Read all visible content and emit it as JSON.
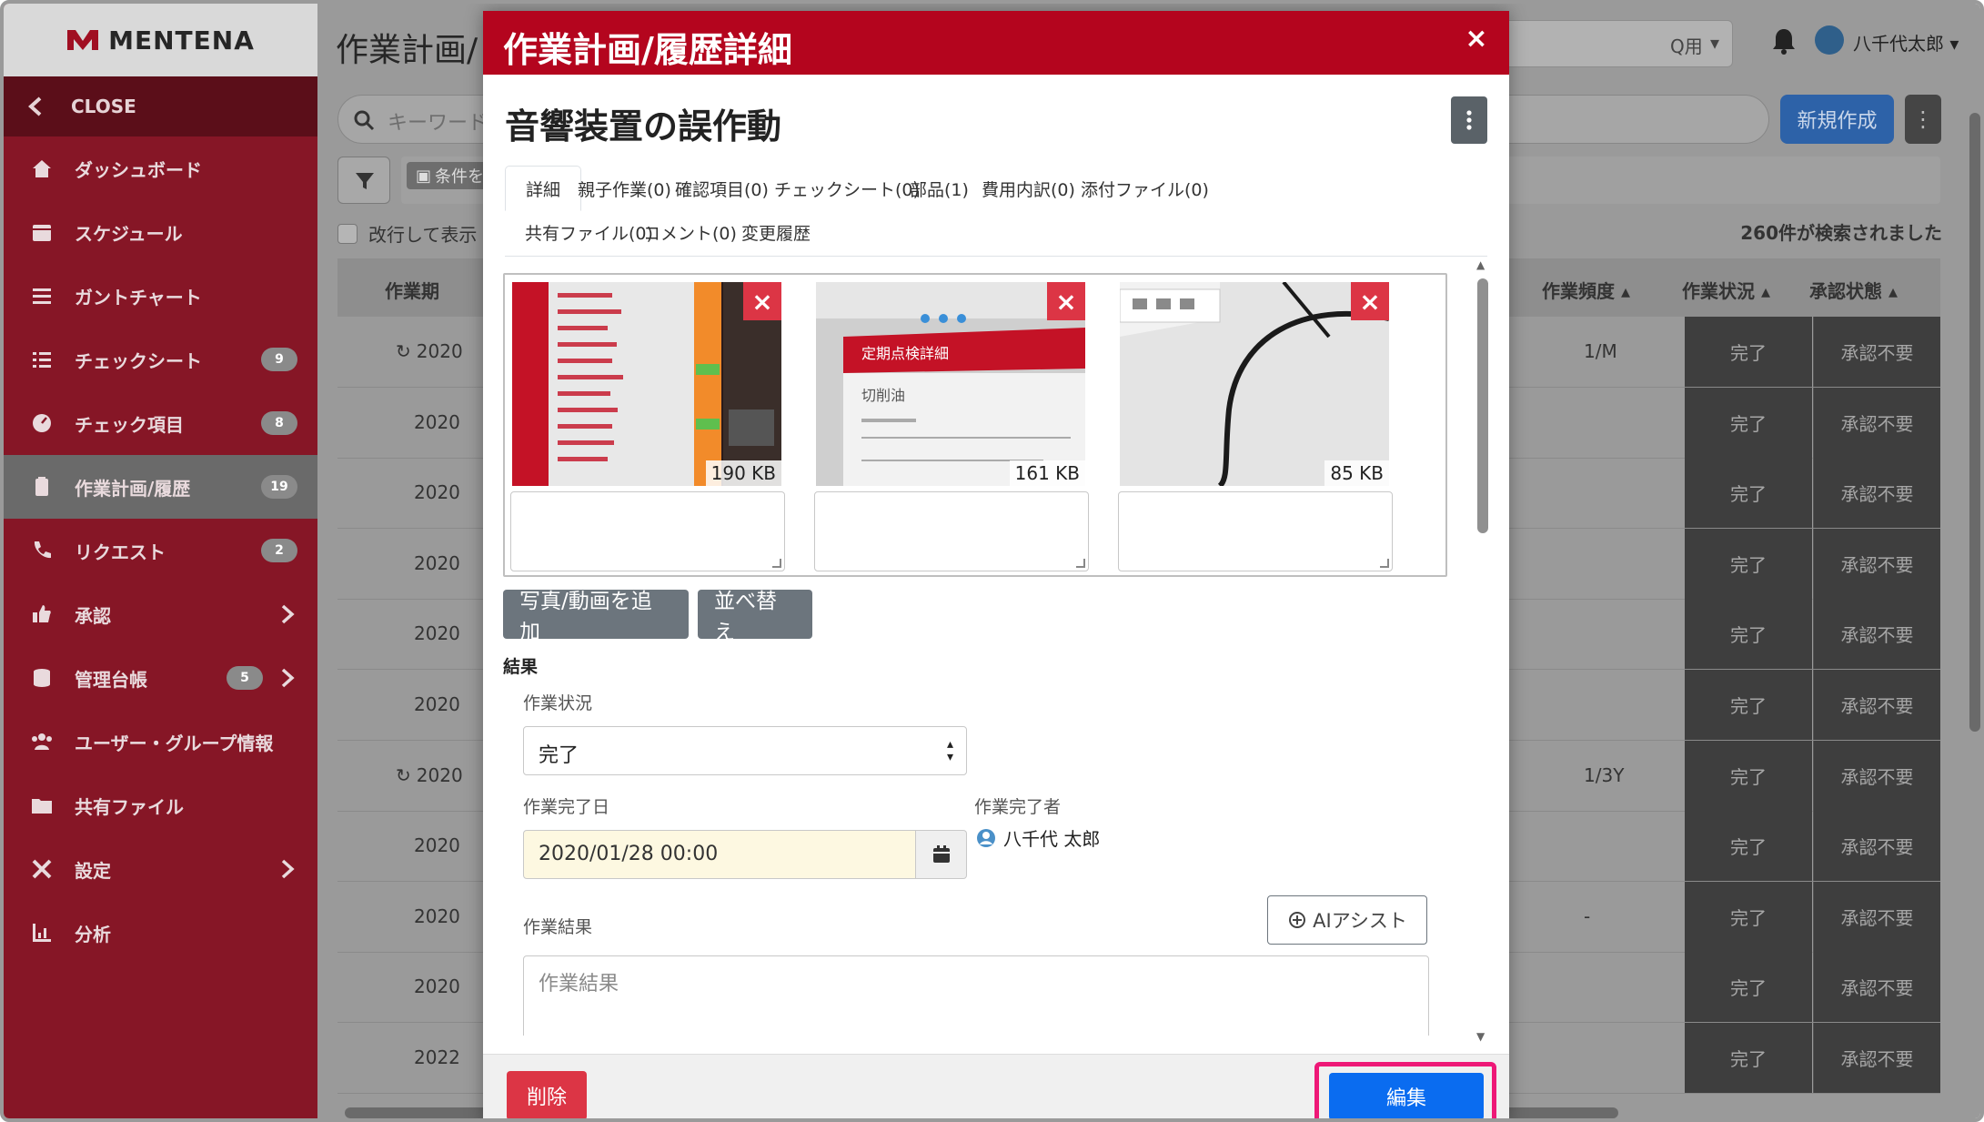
{
  "app": {
    "logo": "MENTENA",
    "page_title": "作業計画/",
    "workspace_suffix": "Q用",
    "user_name": "八千代太郎",
    "search_placeholder": "キーワード",
    "new_button": "新規作成",
    "condition_chip": "条件を",
    "wrap_label": "改行して表示",
    "result_count": "260件が検索されました"
  },
  "sidebar": {
    "close_label": "CLOSE",
    "items": [
      {
        "label": "ダッシュボード",
        "icon": "home-icon",
        "badge": "",
        "chevron": false
      },
      {
        "label": "スケジュール",
        "icon": "calendar-icon",
        "badge": "",
        "chevron": false
      },
      {
        "label": "ガントチャート",
        "icon": "bars-icon",
        "badge": "",
        "chevron": false
      },
      {
        "label": "チェックシート",
        "icon": "checklist-icon",
        "badge": "9",
        "chevron": false
      },
      {
        "label": "チェック項目",
        "icon": "gauge-icon",
        "badge": "8",
        "chevron": false
      },
      {
        "label": "作業計画/履歴",
        "icon": "clipboard-icon",
        "badge": "19",
        "chevron": false
      },
      {
        "label": "リクエスト",
        "icon": "phone-icon",
        "badge": "2",
        "chevron": false
      },
      {
        "label": "承認",
        "icon": "thumbs-up-icon",
        "badge": "",
        "chevron": true
      },
      {
        "label": "管理台帳",
        "icon": "database-icon",
        "badge": "5",
        "chevron": true
      },
      {
        "label": "ユーザー・グループ情報",
        "icon": "users-icon",
        "badge": "",
        "chevron": false
      },
      {
        "label": "共有ファイル",
        "icon": "folder-icon",
        "badge": "",
        "chevron": false
      },
      {
        "label": "設定",
        "icon": "tools-icon",
        "badge": "",
        "chevron": true
      },
      {
        "label": "分析",
        "icon": "chart-icon",
        "badge": "",
        "chevron": false
      }
    ]
  },
  "table": {
    "headers": {
      "date": "作業期",
      "freq": "作業頻度",
      "status": "作業状況",
      "approval": "承認状態"
    },
    "rows": [
      {
        "date": "2020",
        "repeat": true,
        "freq": "1/M",
        "status": "完了",
        "approval": "承認不要"
      },
      {
        "date": "2020",
        "repeat": false,
        "freq": "",
        "status": "完了",
        "approval": "承認不要"
      },
      {
        "date": "2020",
        "repeat": false,
        "freq": "",
        "status": "完了",
        "approval": "承認不要"
      },
      {
        "date": "2020",
        "repeat": false,
        "freq": "",
        "status": "完了",
        "approval": "承認不要"
      },
      {
        "date": "2020",
        "repeat": false,
        "freq": "",
        "status": "完了",
        "approval": "承認不要"
      },
      {
        "date": "2020",
        "repeat": false,
        "freq": "",
        "status": "完了",
        "approval": "承認不要"
      },
      {
        "date": "2020",
        "repeat": true,
        "freq": "1/3Y",
        "status": "完了",
        "approval": "承認不要"
      },
      {
        "date": "2020",
        "repeat": false,
        "freq": "",
        "status": "完了",
        "approval": "承認不要"
      },
      {
        "date": "2020",
        "repeat": false,
        "freq": "-",
        "status": "完了",
        "approval": "承認不要"
      },
      {
        "date": "2020",
        "repeat": false,
        "freq": "",
        "status": "完了",
        "approval": "承認不要"
      },
      {
        "date": "2022",
        "repeat": false,
        "freq": "",
        "status": "完了",
        "approval": "承認不要"
      }
    ]
  },
  "modal": {
    "header": "作業計画/履歴詳細",
    "close": "×",
    "task_title": "音響装置の誤作動",
    "tabs": [
      "詳細",
      "親子作業(0)",
      "確認項目(0)",
      "チェックシート(0)",
      "部品(1)",
      "費用内訳(0)",
      "添付ファイル(0)",
      "共有ファイル(0)",
      "コメント(0)",
      "変更履歴"
    ],
    "active_tab": "詳細",
    "photos": [
      {
        "size": "190 KB",
        "caption": ""
      },
      {
        "size": "161 KB",
        "caption": ""
      },
      {
        "size": "85 KB",
        "caption": ""
      }
    ],
    "photo2_text": {
      "title": "定期点検詳細",
      "sub": "切削油"
    },
    "add_photo_button": "写真/動画を追加",
    "sort_button": "並べ替え",
    "result_section": "結果",
    "status_label": "作業状況",
    "status_value": "完了",
    "done_date_label": "作業完了日",
    "done_date_value": "2020/01/28 00:00",
    "done_by_label": "作業完了者",
    "done_by_value": "八千代 太郎",
    "ai_button": "AIアシスト",
    "result_label": "作業結果",
    "result_placeholder": "作業結果",
    "delete_button": "削除",
    "edit_button": "編集"
  },
  "colors": {
    "modal_header": "#b4051e",
    "sidebar": "#861626",
    "delete": "#dc3545",
    "edit": "#0a6cf0",
    "highlight": "#ee1877"
  }
}
